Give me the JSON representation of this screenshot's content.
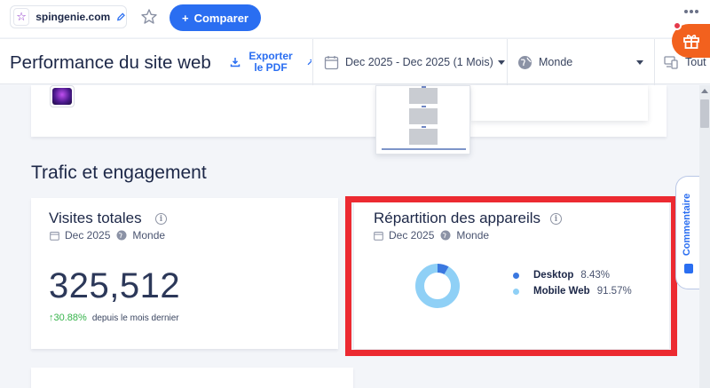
{
  "toolbar": {
    "site_name": "spingenie.com",
    "compare_label": "Comparer"
  },
  "header": {
    "title": "Performance du site web",
    "export_label": "Exporter le PDF",
    "date_range": "Dec 2025 - Dec 2025 (1 Mois)",
    "region": "Monde",
    "device": "Tout"
  },
  "section": {
    "title": "Trafic et engagement"
  },
  "visits_card": {
    "title": "Visites totales",
    "date": "Dec 2025",
    "region": "Monde",
    "value": "325,512",
    "growth": "↑30.88%",
    "growth_desc": "depuis le mois dernier"
  },
  "devices_card": {
    "title": "Répartition des appareils",
    "date": "Dec 2025",
    "region": "Monde",
    "legend": [
      {
        "name": "Desktop",
        "value": "8.43%",
        "color": "#3a78e0"
      },
      {
        "name": "Mobile Web",
        "value": "91.57%",
        "color": "#8fd0f6"
      }
    ]
  },
  "chart_data": {
    "type": "pie",
    "style": "donut",
    "categories": [
      "Desktop",
      "Mobile Web"
    ],
    "values": [
      8.43,
      91.57
    ],
    "colors": [
      "#3a78e0",
      "#8fd0f6"
    ],
    "title": "",
    "legend_position": "right"
  },
  "side_tab": {
    "label": "Commentaire"
  },
  "colors": {
    "accent": "#2a6ef1",
    "highlight": "#ec2a31",
    "positive": "#35b34a",
    "gift": "#f2611e"
  }
}
